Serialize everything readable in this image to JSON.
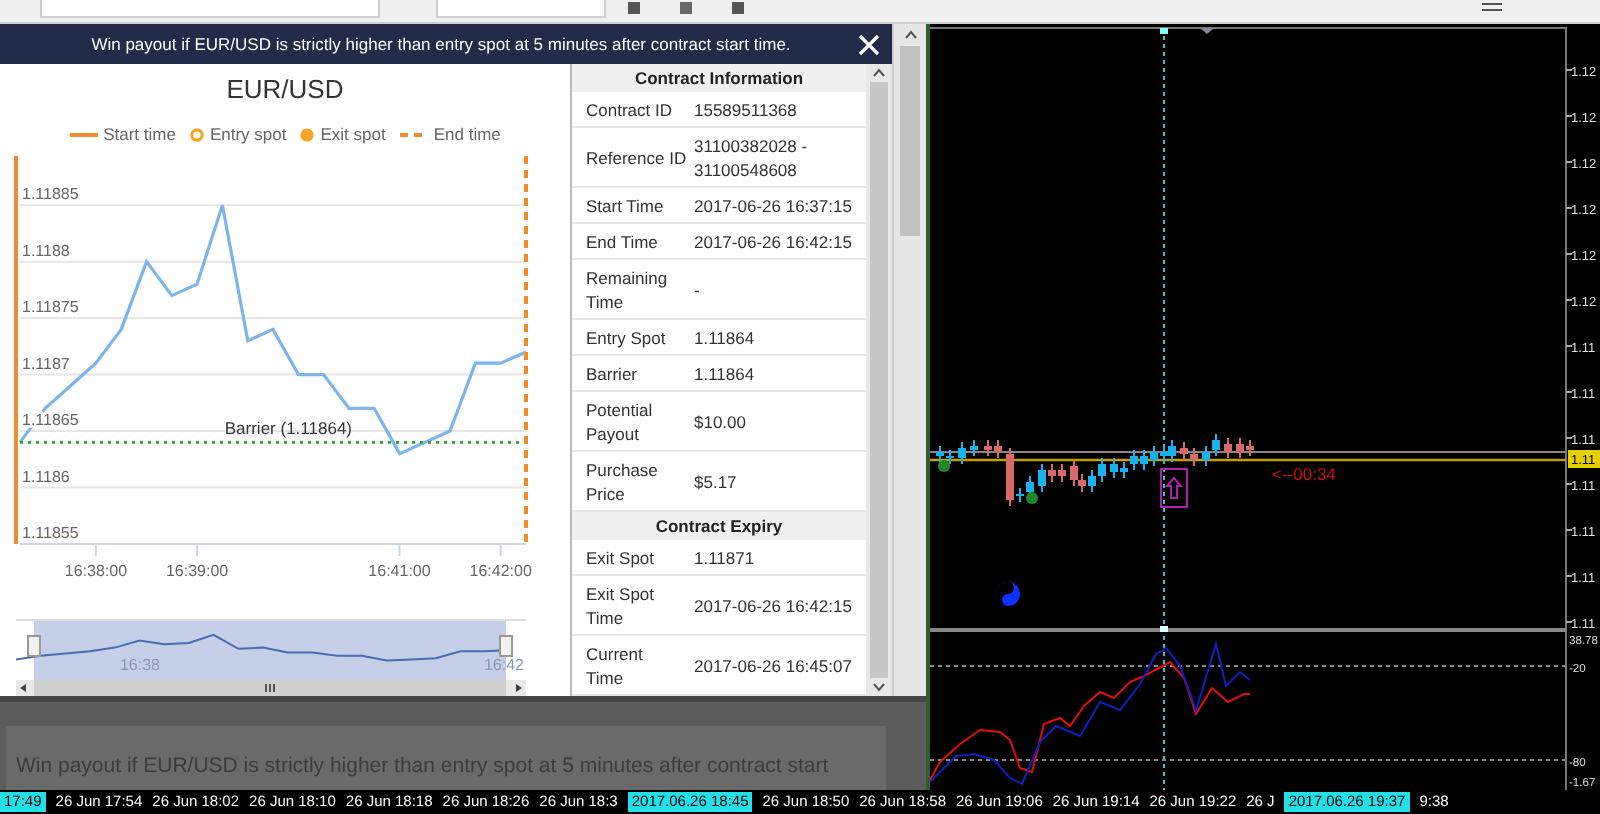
{
  "dialog": {
    "title": "Win payout if EUR/USD is strictly higher than entry spot at 5 minutes after contract start time."
  },
  "chart": {
    "legend": [
      {
        "label": "Start time",
        "kind": "line"
      },
      {
        "label": "Entry spot",
        "kind": "ring"
      },
      {
        "label": "Exit spot",
        "kind": "dot"
      },
      {
        "label": "End time",
        "kind": "dash"
      }
    ],
    "chart_data": {
      "type": "line",
      "title": "EUR/USD",
      "categories": [
        null,
        null,
        null,
        "16:38:00",
        null,
        null,
        null,
        "16:39:00",
        null,
        null,
        null,
        null,
        null,
        null,
        null,
        "16:41:00",
        null,
        null,
        null,
        "16:42:00",
        null
      ],
      "series": [
        {
          "color": "#7cb5ec",
          "values": [
            1.11864,
            1.11867,
            1.11869,
            1.11871,
            1.11874,
            1.1188,
            1.11877,
            1.11878,
            1.11885,
            1.11873,
            1.11874,
            1.1187,
            1.1187,
            1.11867,
            1.11867,
            1.11863,
            1.11864,
            1.11865,
            1.11871,
            1.11871,
            1.11872
          ]
        }
      ],
      "ylim": [
        1.11855,
        1.11889
      ],
      "yticks": [
        1.11855,
        1.1186,
        1.11865,
        1.1187,
        1.11875,
        1.1188,
        1.11885
      ],
      "grid": true,
      "ref_lines": [
        {
          "axis": "y",
          "value": 1.11864,
          "label": "Barrier (1.11864)"
        }
      ]
    },
    "navigator_labels": [
      "16:38",
      "16:42"
    ]
  },
  "contract_table": {
    "sections": [
      {
        "heading": "Contract Information",
        "rows": [
          {
            "label": "Contract ID",
            "value": "15589511368"
          },
          {
            "label": "Reference ID",
            "value": "31100382028 - 31100548608"
          },
          {
            "label": "Start Time",
            "value": "2017-06-26 16:37:15"
          },
          {
            "label": "End Time",
            "value": "2017-06-26 16:42:15"
          },
          {
            "label": "Remaining\nTime",
            "value": "-"
          },
          {
            "label": "Entry Spot",
            "value": "1.11864"
          },
          {
            "label": "Barrier",
            "value": "1.11864"
          },
          {
            "label": "Potential\nPayout",
            "value": "$10.00"
          },
          {
            "label": "Purchase\nPrice",
            "value": "$5.17"
          }
        ]
      },
      {
        "heading": "Contract Expiry",
        "rows": [
          {
            "label": "Exit Spot",
            "value": "1.11871"
          },
          {
            "label": "Exit Spot\nTime",
            "value": "2017-06-26 16:42:15"
          },
          {
            "label": "Current\nTime",
            "value": "2017-06-26 16:45:07"
          }
        ]
      }
    ]
  },
  "overlay_text": "Win payout if EUR/USD is strictly higher than entry spot at 5 minutes after contract start",
  "trading_chart": {
    "price_labels": [
      "1.12",
      "1.12",
      "1.12",
      "1.12",
      "1.12",
      "1.12",
      "1.11",
      "1.11",
      "1.11",
      "1.11",
      "1.11",
      "1.11",
      "1.11"
    ],
    "current_price": "1.11",
    "timer": "<--00:34",
    "oscillator_labels": [
      "38.78",
      "-20",
      "-80",
      "-1.67"
    ]
  },
  "time_axis": [
    {
      "label": "17:49",
      "highlight": true
    },
    {
      "label": "26 Jun 17:54",
      "highlight": false
    },
    {
      "label": "26 Jun 18:02",
      "highlight": false
    },
    {
      "label": "26 Jun 18:10",
      "highlight": false
    },
    {
      "label": "26 Jun 18:18",
      "highlight": false
    },
    {
      "label": "26 Jun 18:26",
      "highlight": false
    },
    {
      "label": "26 Jun 18:3",
      "highlight": false
    },
    {
      "label": "2017.06.26 18:45",
      "highlight": true
    },
    {
      "label": "26 Jun 18:50",
      "highlight": false
    },
    {
      "label": "26 Jun 18:58",
      "highlight": false
    },
    {
      "label": "26 Jun 19:06",
      "highlight": false
    },
    {
      "label": "26 Jun 19:14",
      "highlight": false
    },
    {
      "label": "26 Jun 19:22",
      "highlight": false
    },
    {
      "label": "26 J",
      "highlight": false
    },
    {
      "label": "2017.06.26 19:37",
      "highlight": true
    },
    {
      "label": "9:38",
      "highlight": false
    }
  ]
}
